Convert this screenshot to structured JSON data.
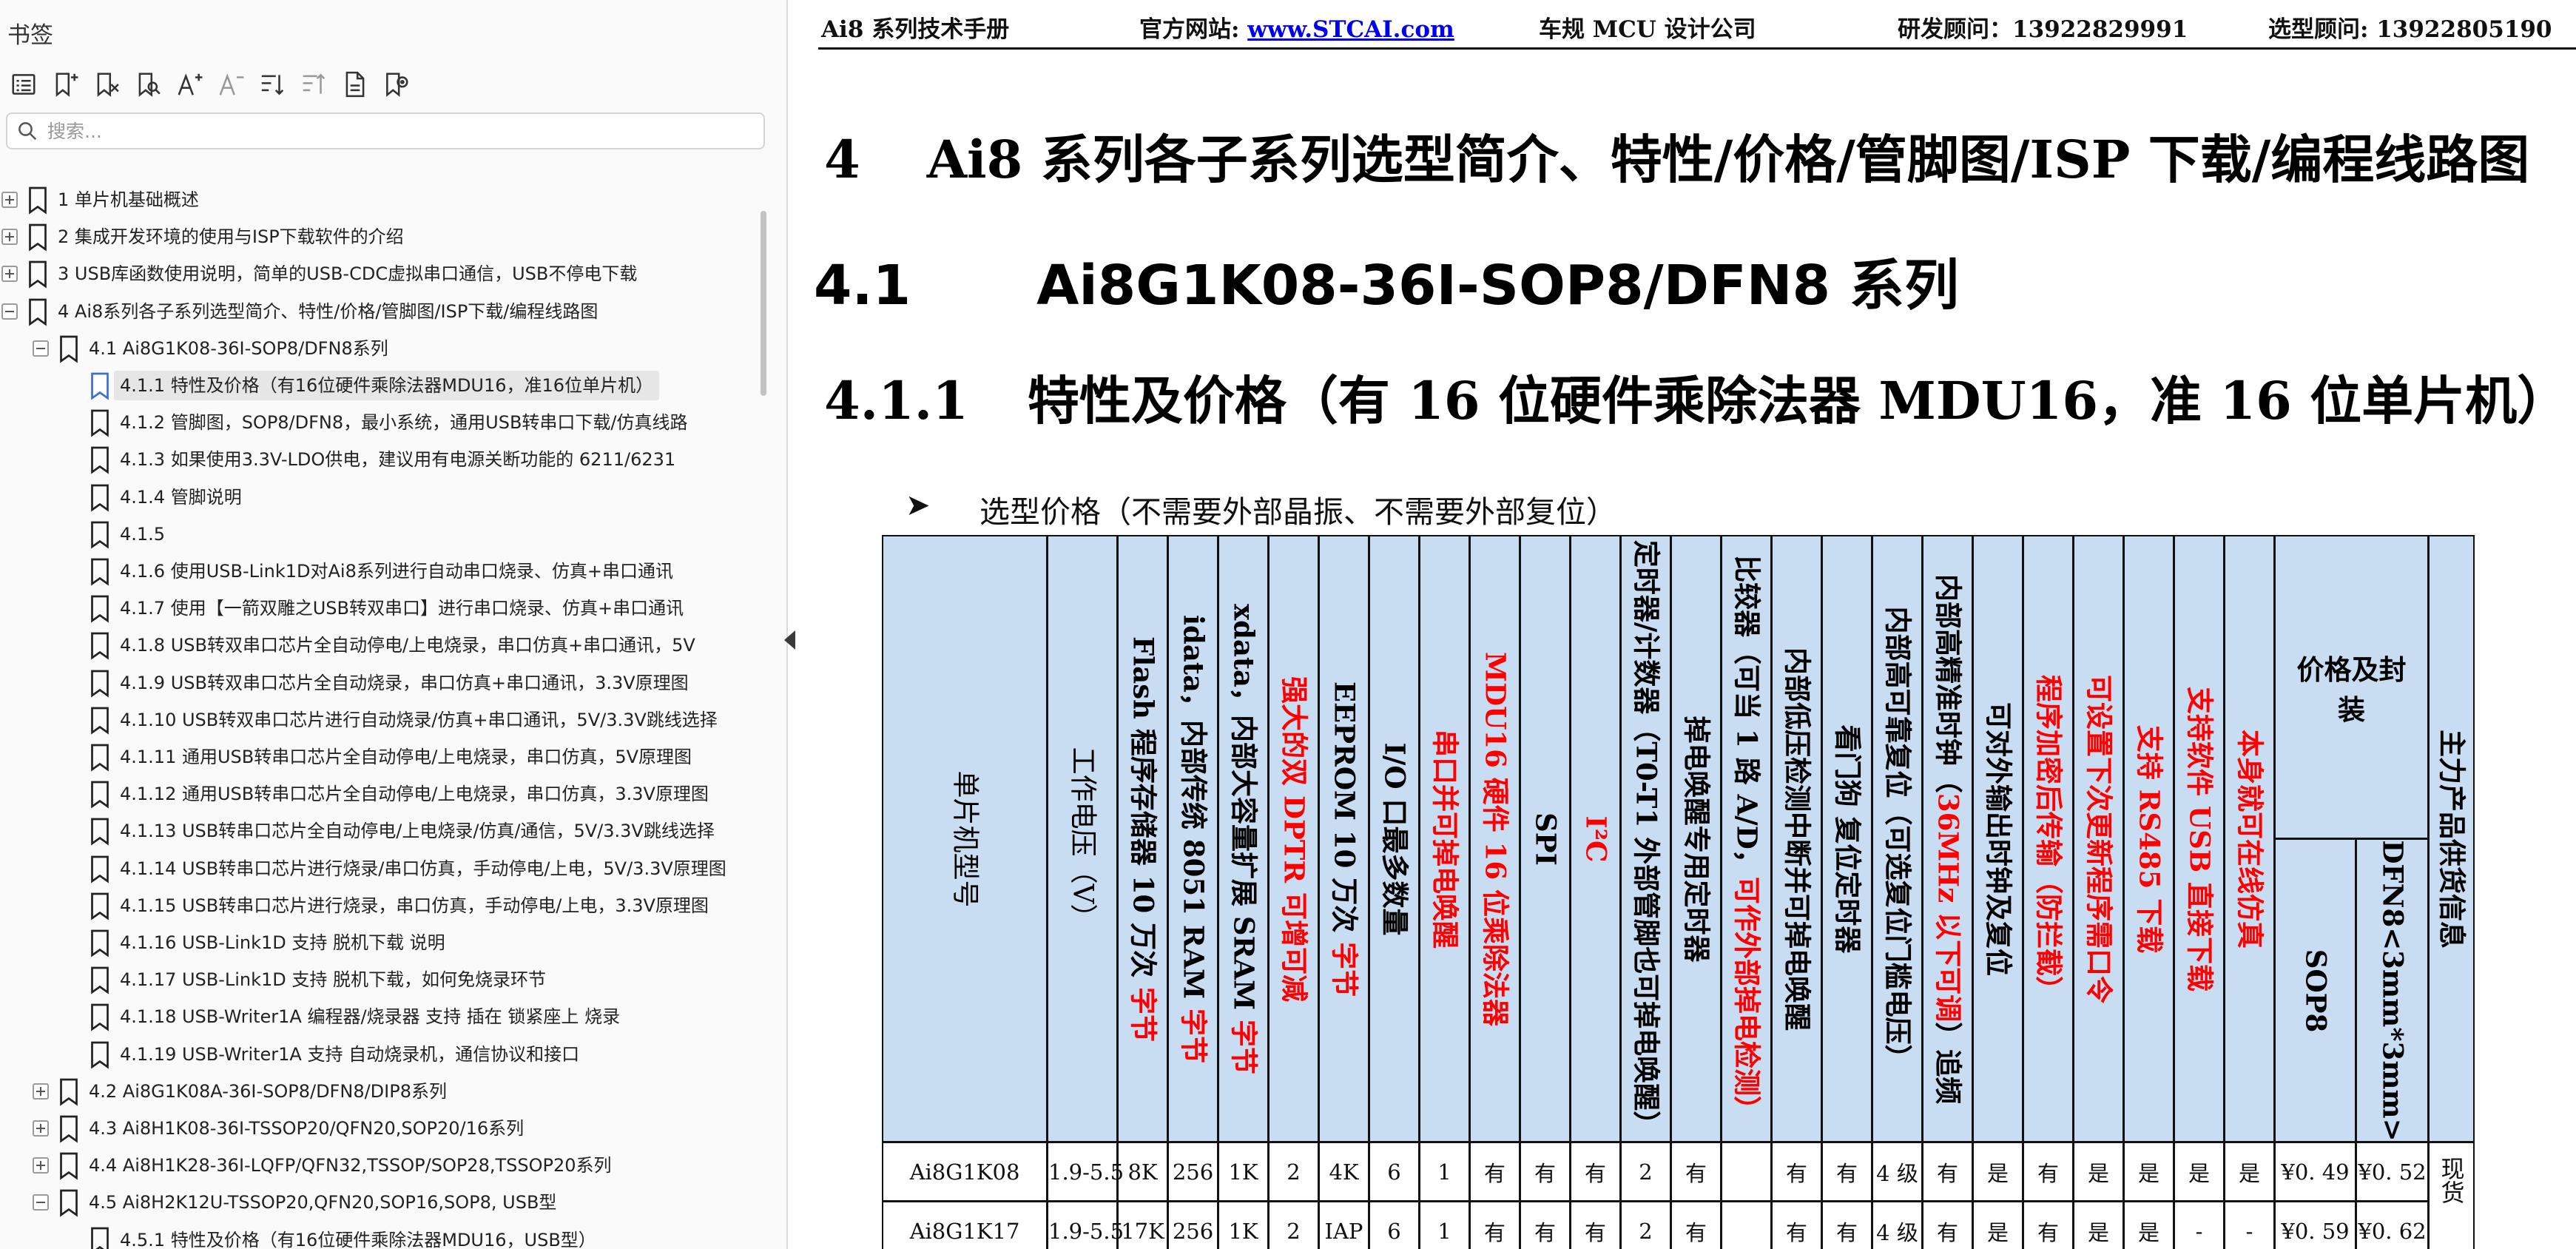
{
  "sidebar": {
    "title": "书签",
    "search_placeholder": "搜索...",
    "toolbar_icons": [
      "outline-icon",
      "add-bookmark-icon",
      "delete-bookmark-icon",
      "find-bookmark-icon",
      "font-larger-icon",
      "font-smaller-icon",
      "expand-all-icon",
      "collapse-all-icon",
      "page-icon",
      "locate-bookmark-icon"
    ],
    "bookmarks": [
      {
        "level": 0,
        "expander": "plus",
        "label": "1 单片机基础概述"
      },
      {
        "level": 0,
        "expander": "plus",
        "label": "2  集成开发环境的使用与ISP下载软件的介绍"
      },
      {
        "level": 0,
        "expander": "plus",
        "label": "3 USB库函数使用说明，简单的USB-CDC虚拟串口通信，USB不停电下载"
      },
      {
        "level": 0,
        "expander": "minus",
        "label": "4  Ai8系列各子系列选型简介、特性/价格/管脚图/ISP下载/编程线路图"
      },
      {
        "level": 1,
        "expander": "minus",
        "label": "4.1 Ai8G1K08-36I-SOP8/DFN8系列"
      },
      {
        "level": 2,
        "expander": "none",
        "label": "4.1.1 特性及价格（有16位硬件乘除法器MDU16，准16位单片机）",
        "selected": true
      },
      {
        "level": 2,
        "expander": "none",
        "label": "4.1.2  管脚图，SOP8/DFN8，最小系统，通用USB转串口下载/仿真线路"
      },
      {
        "level": 2,
        "expander": "none",
        "label": "4.1.3  如果使用3.3V-LDO供电，建议用有电源关断功能的 6211/6231"
      },
      {
        "level": 2,
        "expander": "none",
        "label": "4.1.4  管脚说明"
      },
      {
        "level": 2,
        "expander": "none",
        "label": "4.1.5"
      },
      {
        "level": 2,
        "expander": "none",
        "label": "4.1.6 使用USB-Link1D对Ai8系列进行自动串口烧录、仿真+串口通讯"
      },
      {
        "level": 2,
        "expander": "none",
        "label": "4.1.7  使用【一箭双雕之USB转双串口】进行串口烧录、仿真+串口通讯"
      },
      {
        "level": 2,
        "expander": "none",
        "label": "4.1.8  USB转双串口芯片全自动停电/上电烧录，串口仿真+串口通讯，5V"
      },
      {
        "level": 2,
        "expander": "none",
        "label": "4.1.9  USB转双串口芯片全自动烧录，串口仿真+串口通讯，3.3V原理图"
      },
      {
        "level": 2,
        "expander": "none",
        "label": "4.1.10  USB转双串口芯片进行自动烧录/仿真+串口通讯，5V/3.3V跳线选择"
      },
      {
        "level": 2,
        "expander": "none",
        "label": "4.1.11  通用USB转串口芯片全自动停电/上电烧录，串口仿真，5V原理图"
      },
      {
        "level": 2,
        "expander": "none",
        "label": "4.1.12  通用USB转串口芯片全自动停电/上电烧录，串口仿真，3.3V原理图"
      },
      {
        "level": 2,
        "expander": "none",
        "label": "4.1.13  USB转串口芯片全自动停电/上电烧录/仿真/通信，5V/3.3V跳线选择"
      },
      {
        "level": 2,
        "expander": "none",
        "label": "4.1.14  USB转串口芯片进行烧录/串口仿真，手动停电/上电，5V/3.3V原理图"
      },
      {
        "level": 2,
        "expander": "none",
        "label": "4.1.15  USB转串口芯片进行烧录，串口仿真，手动停电/上电，3.3V原理图"
      },
      {
        "level": 2,
        "expander": "none",
        "label": "4.1.16  USB-Link1D 支持 脱机下载 说明"
      },
      {
        "level": 2,
        "expander": "none",
        "label": "4.1.17  USB-Link1D 支持 脱机下载，如何免烧录环节"
      },
      {
        "level": 2,
        "expander": "none",
        "label": "4.1.18  USB-Writer1A 编程器/烧录器 支持 插在 锁紧座上 烧录"
      },
      {
        "level": 2,
        "expander": "none",
        "label": "4.1.19  USB-Writer1A 支持 自动烧录机，通信协议和接口"
      },
      {
        "level": 1,
        "expander": "plus",
        "label": "4.2  Ai8G1K08A-36I-SOP8/DFN8/DIP8系列"
      },
      {
        "level": 1,
        "expander": "plus",
        "label": "4.3  Ai8H1K08-36I-TSSOP20/QFN20,SOP20/16系列"
      },
      {
        "level": 1,
        "expander": "plus",
        "label": "4.4  Ai8H1K28-36I-LQFP/QFN32,TSSOP/SOP28,TSSOP20系列"
      },
      {
        "level": 1,
        "expander": "minus",
        "label": "4.5  Ai8H2K12U-TSSOP20,QFN20,SOP16,SOP8, USB型"
      },
      {
        "level": 2,
        "expander": "none",
        "label": "4.5.1 特性及价格（有16位硬件乘除法器MDU16，USB型）"
      }
    ]
  },
  "doc": {
    "header": {
      "manual": "Ai8 系列技术手册",
      "site_label": "官方网站: ",
      "site_link": "www.STCAI.com",
      "company": "车规 MCU 设计公司",
      "rd_contact": "研发顾问：13922829991",
      "sel_contact": "选型顾问: 13922805190"
    },
    "h1": {
      "num": "4",
      "text": "Ai8 系列各子系列选型简介、特性/价格/管脚图/ISP 下载/编程线路图"
    },
    "h2": {
      "num": "4.1",
      "text": "Ai8G1K08-36I-SOP8/DFN8 系列"
    },
    "h3": {
      "num": "4.1.1",
      "text": "特性及价格（有 16 位硬件乘除法器 MDU16，准 16 位单片机）"
    },
    "bullet": "选型价格（不需要外部晶振、不需要外部复位）",
    "table": {
      "headers": [
        {
          "parts": [
            {
              "t": "单片机型号"
            }
          ],
          "plain": true
        },
        {
          "parts": [
            {
              "t": "工作电压（V）"
            }
          ],
          "plain": true
        },
        {
          "parts": [
            {
              "t": "Flash 程序存储器  10 万次  "
            },
            {
              "t": "字节",
              "red": true
            }
          ]
        },
        {
          "parts": [
            {
              "t": "idata，内部传统 8051 RAM  "
            },
            {
              "t": "字节",
              "red": true
            }
          ]
        },
        {
          "parts": [
            {
              "t": "xdata，内部大容量扩展 SRAM  "
            },
            {
              "t": "字节",
              "red": true
            }
          ]
        },
        {
          "parts": [
            {
              "t": "强大的双 DPTR 可增可减",
              "red": true
            }
          ]
        },
        {
          "parts": [
            {
              "t": "EEPROM  10 万次  "
            },
            {
              "t": "字节",
              "red": true
            }
          ]
        },
        {
          "parts": [
            {
              "t": "I/O 口最多数量"
            }
          ]
        },
        {
          "parts": [
            {
              "t": "串口并可掉电唤醒",
              "red": true
            }
          ]
        },
        {
          "parts": [
            {
              "t": "MDU16 硬件 16 位乘除法器",
              "red": true
            }
          ]
        },
        {
          "parts": [
            {
              "t": "SPI"
            }
          ]
        },
        {
          "parts": [
            {
              "t": "I²C",
              "red": true
            }
          ]
        },
        {
          "parts": [
            {
              "t": "定时器/计数器（T0-T1 外部管脚也可掉电唤醒）"
            }
          ]
        },
        {
          "parts": [
            {
              "t": "掉电唤醒专用定时器"
            }
          ]
        },
        {
          "parts": [
            {
              "t": "比较器（可当 1 路 A/D，"
            },
            {
              "t": "可作外部掉电检测）",
              "red": true
            }
          ]
        },
        {
          "parts": [
            {
              "t": "内部低压检测中断并可掉电唤醒"
            }
          ]
        },
        {
          "parts": [
            {
              "t": "看门狗  复位定时器"
            }
          ]
        },
        {
          "parts": [
            {
              "t": "内部高可靠复位（可选复位门槛电压）"
            }
          ]
        },
        {
          "parts": [
            {
              "t": "内部高精准时钟（"
            },
            {
              "t": "36MHz 以下可调",
              "red": true
            },
            {
              "t": "）追频"
            }
          ]
        },
        {
          "parts": [
            {
              "t": "可对外输出时钟及复位"
            }
          ]
        },
        {
          "parts": [
            {
              "t": "程序加密后传输（防拦截）",
              "red": true
            }
          ]
        },
        {
          "parts": [
            {
              "t": "可设置下次更新程序需口令",
              "red": true
            }
          ]
        },
        {
          "parts": [
            {
              "t": "支持 RS485 下载",
              "red": true
            }
          ]
        },
        {
          "parts": [
            {
              "t": "支持软件 USB 直接下载",
              "red": true
            }
          ]
        },
        {
          "parts": [
            {
              "t": "本身就可在线仿真",
              "red": true
            }
          ]
        }
      ],
      "price_group": "价格及封装",
      "price_cols": [
        "SOP8",
        "DFN8<3mm*3mm>"
      ],
      "supply_header": "主力产品供货信息",
      "rows": [
        [
          "Ai8G1K08",
          "1.9-5.5",
          "8K",
          "256",
          "1K",
          "2",
          "4K",
          "6",
          "1",
          "有",
          "有",
          "有",
          "2",
          "有",
          "",
          "有",
          "有",
          "4 级",
          "有",
          "是",
          "有",
          "是",
          "是",
          "是",
          "是",
          "¥0. 49",
          "¥0. 52"
        ],
        [
          "Ai8G1K17",
          "1.9-5.5",
          "17K",
          "256",
          "1K",
          "2",
          "IAP",
          "6",
          "1",
          "有",
          "有",
          "有",
          "2",
          "有",
          "",
          "有",
          "有",
          "4 级",
          "有",
          "是",
          "有",
          "是",
          "是",
          "-",
          "-",
          "¥0. 59",
          "¥0. 62"
        ]
      ],
      "supply_value": "现货"
    }
  }
}
